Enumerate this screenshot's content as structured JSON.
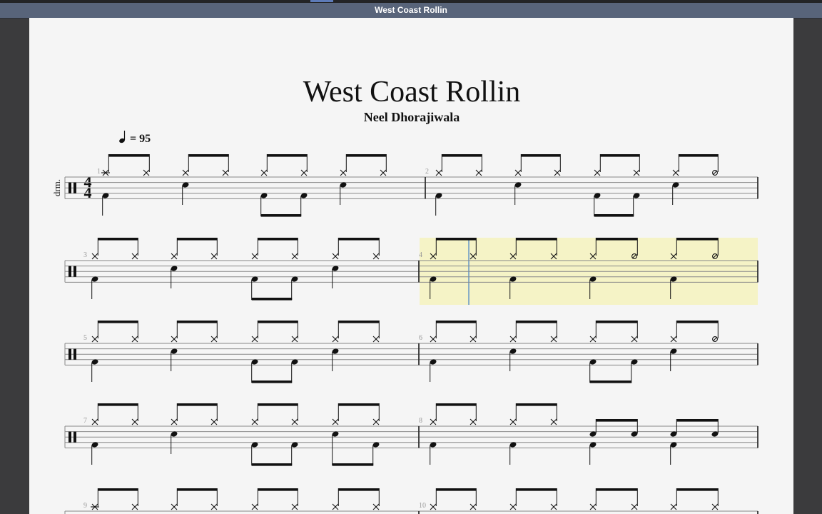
{
  "window": {
    "title": "West Coast Rollin"
  },
  "score": {
    "title": "West Coast Rollin",
    "composer": "Neel Dhorajiwala",
    "tempo": {
      "symbol": "quarter-note",
      "text": "= 95"
    },
    "instrument_short": "drm.",
    "time_signature": {
      "numerator": "4",
      "denominator": "4"
    },
    "selected_measure": 4,
    "colors": {
      "highlight": "#f5f3c6",
      "cursor": "#8aaec6",
      "ink": "#111111"
    },
    "measures": [
      {
        "number": "1",
        "upper": [
          "c",
          "x",
          "x",
          "x",
          "x",
          "x",
          "x",
          "x"
        ],
        "lower": [
          [
            0,
            "k",
            "q"
          ],
          [
            2,
            "s",
            "q"
          ],
          [
            4,
            "k",
            "e"
          ],
          [
            5,
            "k",
            "e"
          ],
          [
            6,
            "s",
            "q"
          ]
        ]
      },
      {
        "number": "2",
        "upper": [
          "x",
          "x",
          "x",
          "x",
          "x",
          "x",
          "x",
          "o"
        ],
        "lower": [
          [
            0,
            "k",
            "q"
          ],
          [
            2,
            "s",
            "q"
          ],
          [
            4,
            "k",
            "e"
          ],
          [
            5,
            "k",
            "e"
          ],
          [
            6,
            "s",
            "q"
          ]
        ]
      },
      {
        "number": "3",
        "upper": [
          "x",
          "x",
          "x",
          "x",
          "x",
          "x",
          "x",
          "x"
        ],
        "lower": [
          [
            0,
            "k",
            "q"
          ],
          [
            2,
            "s",
            "q"
          ],
          [
            4,
            "k",
            "e"
          ],
          [
            5,
            "k",
            "e"
          ],
          [
            6,
            "s",
            "q"
          ]
        ]
      },
      {
        "number": "4",
        "upper": [
          "x",
          "x",
          "x",
          "x",
          "x",
          "o",
          "x",
          "o"
        ],
        "lower": [
          [
            0,
            "k",
            "q"
          ],
          [
            2,
            "k",
            "q"
          ],
          [
            4,
            "k",
            "q"
          ],
          [
            6,
            "k",
            "q"
          ]
        ]
      },
      {
        "number": "5",
        "upper": [
          "x",
          "x",
          "x",
          "x",
          "x",
          "x",
          "x",
          "x"
        ],
        "lower": [
          [
            0,
            "k",
            "q"
          ],
          [
            2,
            "s",
            "q"
          ],
          [
            4,
            "k",
            "e"
          ],
          [
            5,
            "k",
            "e"
          ],
          [
            6,
            "s",
            "q"
          ]
        ]
      },
      {
        "number": "6",
        "upper": [
          "x",
          "x",
          "x",
          "x",
          "x",
          "x",
          "x",
          "o"
        ],
        "lower": [
          [
            0,
            "k",
            "q"
          ],
          [
            2,
            "s",
            "q"
          ],
          [
            4,
            "k",
            "e"
          ],
          [
            5,
            "k",
            "e"
          ],
          [
            6,
            "s",
            "q"
          ]
        ]
      },
      {
        "number": "7",
        "upper": [
          "x",
          "x",
          "x",
          "x",
          "x",
          "x",
          "x",
          "x"
        ],
        "lower": [
          [
            0,
            "k",
            "q"
          ],
          [
            2,
            "s",
            "q"
          ],
          [
            4,
            "k",
            "e"
          ],
          [
            5,
            "k",
            "e"
          ],
          [
            6,
            "s",
            "e"
          ],
          [
            7,
            "k",
            "e"
          ]
        ]
      },
      {
        "number": "8",
        "upper": [
          "x",
          "x",
          "x",
          "x",
          "s",
          "s",
          "s",
          "s"
        ],
        "lower": [
          [
            0,
            "k",
            "q"
          ],
          [
            2,
            "k",
            "q"
          ],
          [
            4,
            "k",
            "q"
          ],
          [
            6,
            "k",
            "q"
          ]
        ]
      },
      {
        "number": "9",
        "upper": [
          "c",
          "x",
          "x",
          "x",
          "x",
          "x",
          "x",
          "x"
        ],
        "lower": []
      },
      {
        "number": "10",
        "upper": [
          "x",
          "x",
          "x",
          "x",
          "x",
          "x",
          "x",
          "x"
        ],
        "lower": []
      }
    ]
  }
}
